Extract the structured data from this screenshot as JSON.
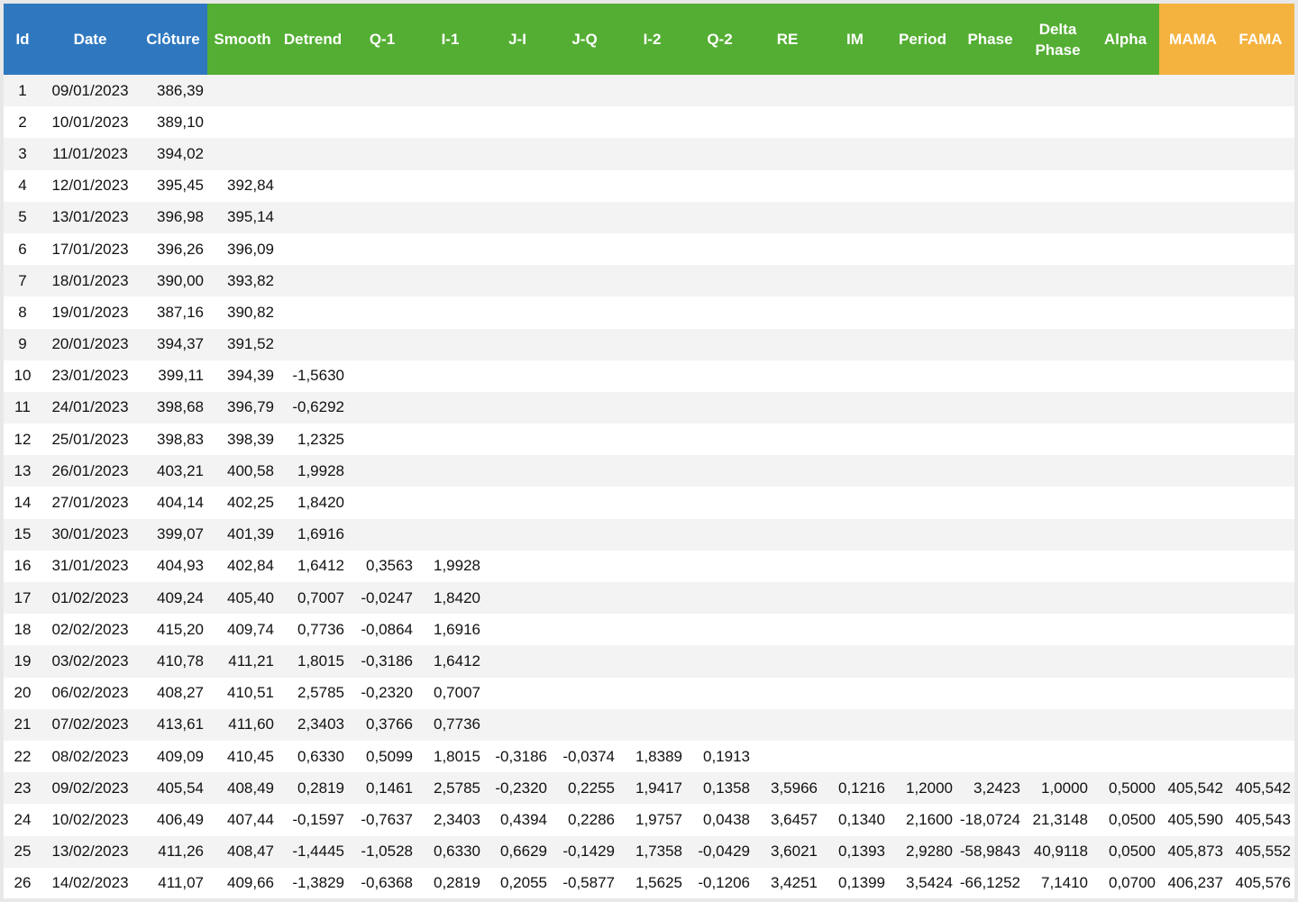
{
  "columns": [
    {
      "label": "Id",
      "group": "blue",
      "key": "id"
    },
    {
      "label": "Date",
      "group": "blue",
      "key": "date"
    },
    {
      "label": "Clôture",
      "group": "blue",
      "key": "close"
    },
    {
      "label": "Smooth",
      "group": "green",
      "key": "smooth"
    },
    {
      "label": "Detrend",
      "group": "green",
      "key": "detrend"
    },
    {
      "label": "Q-1",
      "group": "green",
      "key": "q1"
    },
    {
      "label": "I-1",
      "group": "green",
      "key": "i1"
    },
    {
      "label": "J-I",
      "group": "green",
      "key": "ji"
    },
    {
      "label": "J-Q",
      "group": "green",
      "key": "jq"
    },
    {
      "label": "I-2",
      "group": "green",
      "key": "i2"
    },
    {
      "label": "Q-2",
      "group": "green",
      "key": "q2"
    },
    {
      "label": "RE",
      "group": "green",
      "key": "re"
    },
    {
      "label": "IM",
      "group": "green",
      "key": "im"
    },
    {
      "label": "Period",
      "group": "green",
      "key": "period"
    },
    {
      "label": "Phase",
      "group": "green",
      "key": "phase"
    },
    {
      "label": "Delta\nPhase",
      "group": "green",
      "key": "delta_phase"
    },
    {
      "label": "Alpha",
      "group": "green",
      "key": "alpha"
    },
    {
      "label": "MAMA",
      "group": "orange",
      "key": "mama"
    },
    {
      "label": "FAMA",
      "group": "orange",
      "key": "fama"
    }
  ],
  "colors": {
    "blue_header": "#2f78c0",
    "green_header": "#54ae33",
    "orange_header": "#f4b23f",
    "row_stripe": "#f3f3f3"
  },
  "rows": [
    [
      "1",
      "09/01/2023",
      "386,39",
      "",
      "",
      "",
      "",
      "",
      "",
      "",
      "",
      "",
      "",
      "",
      "",
      "",
      "",
      "",
      ""
    ],
    [
      "2",
      "10/01/2023",
      "389,10",
      "",
      "",
      "",
      "",
      "",
      "",
      "",
      "",
      "",
      "",
      "",
      "",
      "",
      "",
      "",
      ""
    ],
    [
      "3",
      "11/01/2023",
      "394,02",
      "",
      "",
      "",
      "",
      "",
      "",
      "",
      "",
      "",
      "",
      "",
      "",
      "",
      "",
      "",
      ""
    ],
    [
      "4",
      "12/01/2023",
      "395,45",
      "392,84",
      "",
      "",
      "",
      "",
      "",
      "",
      "",
      "",
      "",
      "",
      "",
      "",
      "",
      "",
      ""
    ],
    [
      "5",
      "13/01/2023",
      "396,98",
      "395,14",
      "",
      "",
      "",
      "",
      "",
      "",
      "",
      "",
      "",
      "",
      "",
      "",
      "",
      "",
      ""
    ],
    [
      "6",
      "17/01/2023",
      "396,26",
      "396,09",
      "",
      "",
      "",
      "",
      "",
      "",
      "",
      "",
      "",
      "",
      "",
      "",
      "",
      "",
      ""
    ],
    [
      "7",
      "18/01/2023",
      "390,00",
      "393,82",
      "",
      "",
      "",
      "",
      "",
      "",
      "",
      "",
      "",
      "",
      "",
      "",
      "",
      "",
      ""
    ],
    [
      "8",
      "19/01/2023",
      "387,16",
      "390,82",
      "",
      "",
      "",
      "",
      "",
      "",
      "",
      "",
      "",
      "",
      "",
      "",
      "",
      "",
      ""
    ],
    [
      "9",
      "20/01/2023",
      "394,37",
      "391,52",
      "",
      "",
      "",
      "",
      "",
      "",
      "",
      "",
      "",
      "",
      "",
      "",
      "",
      "",
      ""
    ],
    [
      "10",
      "23/01/2023",
      "399,11",
      "394,39",
      "-1,5630",
      "",
      "",
      "",
      "",
      "",
      "",
      "",
      "",
      "",
      "",
      "",
      "",
      "",
      ""
    ],
    [
      "11",
      "24/01/2023",
      "398,68",
      "396,79",
      "-0,6292",
      "",
      "",
      "",
      "",
      "",
      "",
      "",
      "",
      "",
      "",
      "",
      "",
      "",
      ""
    ],
    [
      "12",
      "25/01/2023",
      "398,83",
      "398,39",
      "1,2325",
      "",
      "",
      "",
      "",
      "",
      "",
      "",
      "",
      "",
      "",
      "",
      "",
      "",
      ""
    ],
    [
      "13",
      "26/01/2023",
      "403,21",
      "400,58",
      "1,9928",
      "",
      "",
      "",
      "",
      "",
      "",
      "",
      "",
      "",
      "",
      "",
      "",
      "",
      ""
    ],
    [
      "14",
      "27/01/2023",
      "404,14",
      "402,25",
      "1,8420",
      "",
      "",
      "",
      "",
      "",
      "",
      "",
      "",
      "",
      "",
      "",
      "",
      "",
      ""
    ],
    [
      "15",
      "30/01/2023",
      "399,07",
      "401,39",
      "1,6916",
      "",
      "",
      "",
      "",
      "",
      "",
      "",
      "",
      "",
      "",
      "",
      "",
      "",
      ""
    ],
    [
      "16",
      "31/01/2023",
      "404,93",
      "402,84",
      "1,6412",
      "0,3563",
      "1,9928",
      "",
      "",
      "",
      "",
      "",
      "",
      "",
      "",
      "",
      "",
      "",
      ""
    ],
    [
      "17",
      "01/02/2023",
      "409,24",
      "405,40",
      "0,7007",
      "-0,0247",
      "1,8420",
      "",
      "",
      "",
      "",
      "",
      "",
      "",
      "",
      "",
      "",
      "",
      ""
    ],
    [
      "18",
      "02/02/2023",
      "415,20",
      "409,74",
      "0,7736",
      "-0,0864",
      "1,6916",
      "",
      "",
      "",
      "",
      "",
      "",
      "",
      "",
      "",
      "",
      "",
      ""
    ],
    [
      "19",
      "03/02/2023",
      "410,78",
      "411,21",
      "1,8015",
      "-0,3186",
      "1,6412",
      "",
      "",
      "",
      "",
      "",
      "",
      "",
      "",
      "",
      "",
      "",
      ""
    ],
    [
      "20",
      "06/02/2023",
      "408,27",
      "410,51",
      "2,5785",
      "-0,2320",
      "0,7007",
      "",
      "",
      "",
      "",
      "",
      "",
      "",
      "",
      "",
      "",
      "",
      ""
    ],
    [
      "21",
      "07/02/2023",
      "413,61",
      "411,60",
      "2,3403",
      "0,3766",
      "0,7736",
      "",
      "",
      "",
      "",
      "",
      "",
      "",
      "",
      "",
      "",
      "",
      ""
    ],
    [
      "22",
      "08/02/2023",
      "409,09",
      "410,45",
      "0,6330",
      "0,5099",
      "1,8015",
      "-0,3186",
      "-0,0374",
      "1,8389",
      "0,1913",
      "",
      "",
      "",
      "",
      "",
      "",
      "",
      ""
    ],
    [
      "23",
      "09/02/2023",
      "405,54",
      "408,49",
      "0,2819",
      "0,1461",
      "2,5785",
      "-0,2320",
      "0,2255",
      "1,9417",
      "0,1358",
      "3,5966",
      "0,1216",
      "1,2000",
      "3,2423",
      "1,0000",
      "0,5000",
      "405,542",
      "405,542"
    ],
    [
      "24",
      "10/02/2023",
      "406,49",
      "407,44",
      "-0,1597",
      "-0,7637",
      "2,3403",
      "0,4394",
      "0,2286",
      "1,9757",
      "0,0438",
      "3,6457",
      "0,1340",
      "2,1600",
      "-18,0724",
      "21,3148",
      "0,0500",
      "405,590",
      "405,543"
    ],
    [
      "25",
      "13/02/2023",
      "411,26",
      "408,47",
      "-1,4445",
      "-1,0528",
      "0,6330",
      "0,6629",
      "-0,1429",
      "1,7358",
      "-0,0429",
      "3,6021",
      "0,1393",
      "2,9280",
      "-58,9843",
      "40,9118",
      "0,0500",
      "405,873",
      "405,552"
    ],
    [
      "26",
      "14/02/2023",
      "411,07",
      "409,66",
      "-1,3829",
      "-0,6368",
      "0,2819",
      "0,2055",
      "-0,5877",
      "1,5625",
      "-0,1206",
      "3,4251",
      "0,1399",
      "3,5424",
      "-66,1252",
      "7,1410",
      "0,0700",
      "406,237",
      "405,576"
    ]
  ]
}
